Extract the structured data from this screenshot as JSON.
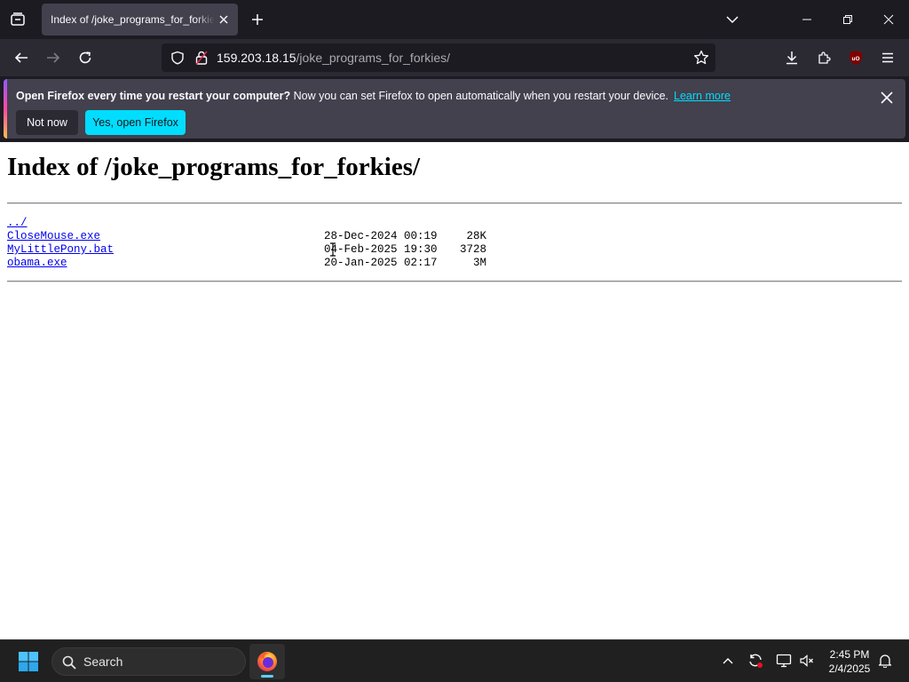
{
  "tab": {
    "title": "Index of /joke_programs_for_forkies/"
  },
  "urlbar": {
    "host": "159.203.18.15",
    "path": "/joke_programs_for_forkies/"
  },
  "notification": {
    "bold_text": "Open Firefox every time you restart your computer?",
    "text": " Now you can set Firefox to open automatically when you restart your device.",
    "link": "Learn more",
    "not_now_label": "Not now",
    "yes_label": "Yes, open Firefox"
  },
  "page": {
    "heading": "Index of /joke_programs_for_forkies/",
    "parent_link": "../",
    "files": [
      {
        "name": "CloseMouse.exe",
        "date": "28-Dec-2024 00:19",
        "size": "28K"
      },
      {
        "name": "MyLittlePony.bat",
        "date": "04-Feb-2025 19:30",
        "size": "3728"
      },
      {
        "name": "obama.exe",
        "date": "20-Jan-2025 02:17",
        "size": "3M"
      }
    ]
  },
  "taskbar": {
    "search_label": "Search",
    "time": "2:45 PM",
    "date": "2/4/2025"
  },
  "colors": {
    "tabstrip_bg": "#1c1b22",
    "toolbar_bg": "#2b2a33",
    "accent_cyan": "#00ddff",
    "link_blue": "#0000ee",
    "taskbar_bg": "#202020"
  },
  "icons": {
    "tab_list": "tab-list-icon",
    "new_tab": "plus-icon",
    "back": "back-arrow-icon",
    "forward": "forward-arrow-icon",
    "reload": "reload-icon",
    "tracking": "shield-icon",
    "connection": "lock-icon",
    "bookmark": "star-icon",
    "downloads": "download-icon",
    "extensions": "puzzle-icon",
    "ublock": "ublock-origin-icon",
    "menu": "hamburger-menu-icon",
    "start": "windows-logo-icon",
    "browser_app": "firefox-icon"
  }
}
